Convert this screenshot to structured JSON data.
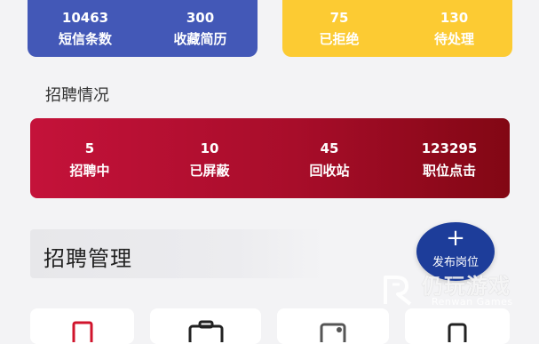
{
  "top_cards": {
    "blue": [
      {
        "value": "10463",
        "label": "短信条数"
      },
      {
        "value": "300",
        "label": "收藏简历"
      }
    ],
    "yellow": [
      {
        "value": "75",
        "label": "已拒绝"
      },
      {
        "value": "130",
        "label": "待处理"
      }
    ]
  },
  "recruit_section": {
    "title": "招聘情况",
    "stats": [
      {
        "value": "5",
        "label": "招聘中"
      },
      {
        "value": "10",
        "label": "已屏蔽"
      },
      {
        "value": "45",
        "label": "回收站"
      },
      {
        "value": "123295",
        "label": "职位点击"
      }
    ]
  },
  "management": {
    "title": "招聘管理",
    "post_button": {
      "icon": "plus-icon",
      "label": "发布岗位"
    }
  },
  "tiles": [
    {
      "icon": "document-icon",
      "color": "#d0142c"
    },
    {
      "icon": "briefcase-icon",
      "color": "#222222"
    },
    {
      "icon": "card-icon",
      "color": "#555555"
    },
    {
      "icon": "clipboard-icon",
      "color": "#222222"
    }
  ],
  "watermark": {
    "text": "仍玩游戏",
    "subtext": "Renwan Games"
  }
}
